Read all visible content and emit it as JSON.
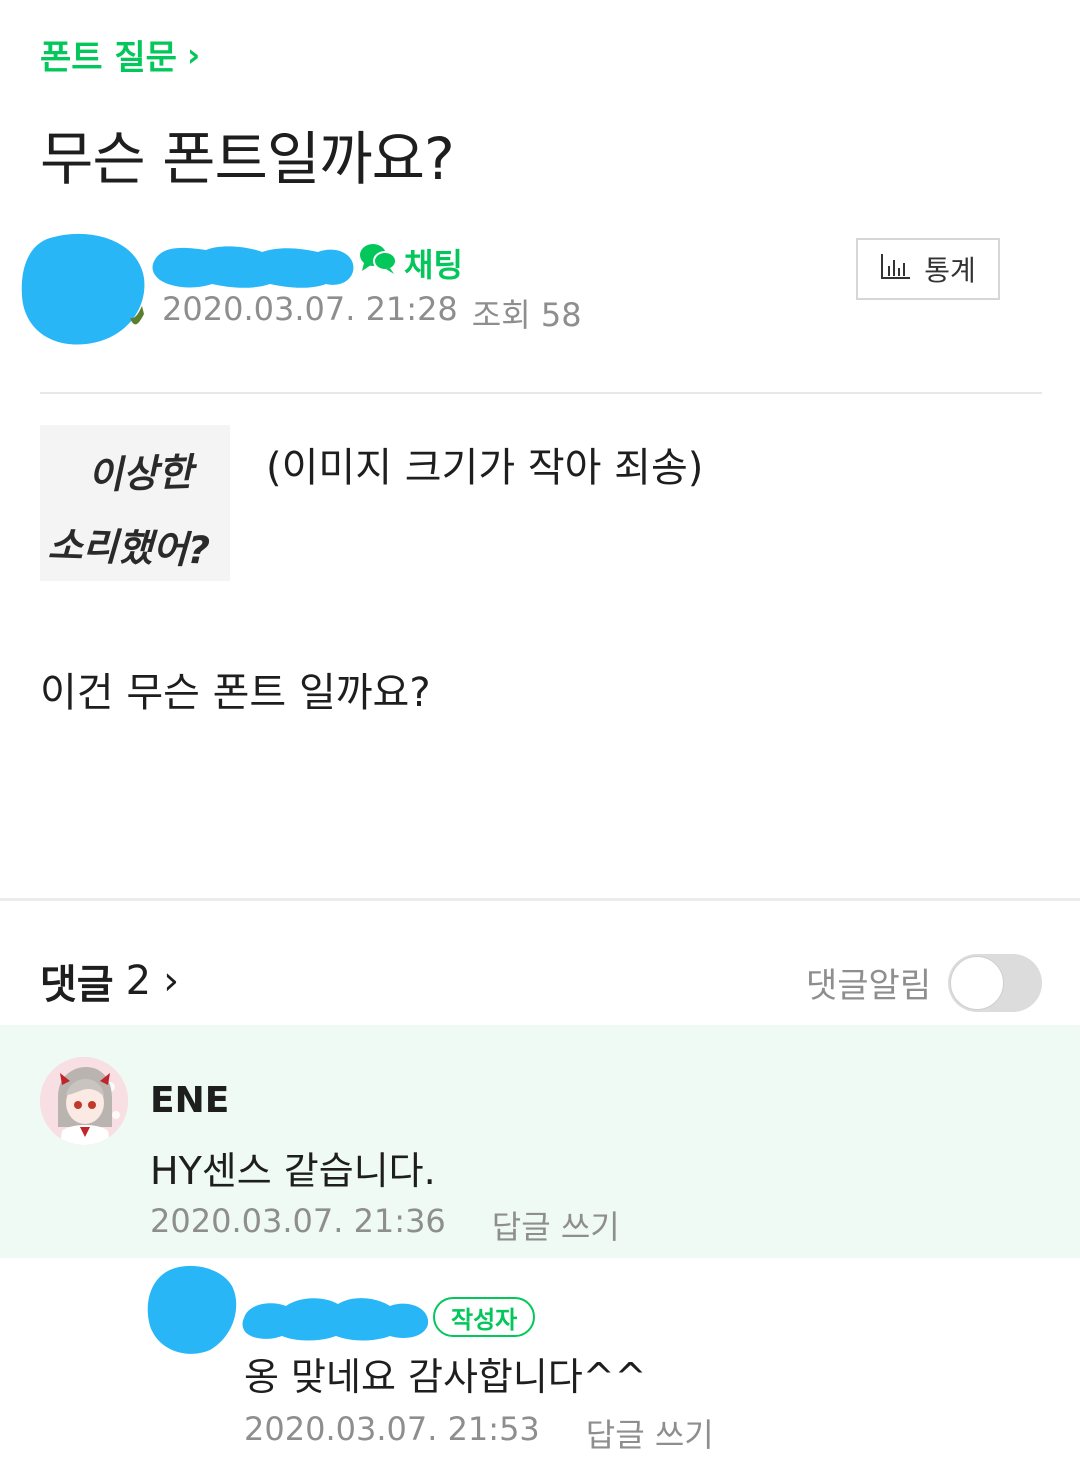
{
  "board": {
    "name": "폰트 질문",
    "chevron": "›"
  },
  "post": {
    "title": "무슨 폰트일까요?",
    "chat_label": "채팅",
    "date": "2020.03.07. 21:28",
    "views_label": "조회",
    "views": "58",
    "stats_label": "통계",
    "image_note": "(이미지 크기가 작아 죄송)",
    "image_text_line1": "이상한",
    "image_text_line2": "소리했어?",
    "body": "이건 무슨 폰트 일까요?"
  },
  "comments": {
    "heading": "댓글",
    "count": "2",
    "chevron": "›",
    "notify_label": "댓글알림",
    "notify_on": false,
    "items": [
      {
        "author": "ENE",
        "text": "HY센스 같습니다.",
        "date": "2020.03.07. 21:36",
        "reply_label": "답글 쓰기"
      },
      {
        "badge": "작성자",
        "text": "옹 맞네요 감사합니다^^",
        "date": "2020.03.07. 21:53",
        "reply_label": "답글 쓰기"
      }
    ]
  },
  "colors": {
    "accent_green": "#03c75a",
    "redaction_blue": "#29b6f6",
    "comment_bg": "#effaf4",
    "meta_gray": "#8e8e8e"
  },
  "icons": {
    "board_chevron": "chevron-right-icon",
    "chat": "chat-bubbles-icon",
    "stats": "bar-chart-icon",
    "comments_chevron": "chevron-right-icon"
  }
}
